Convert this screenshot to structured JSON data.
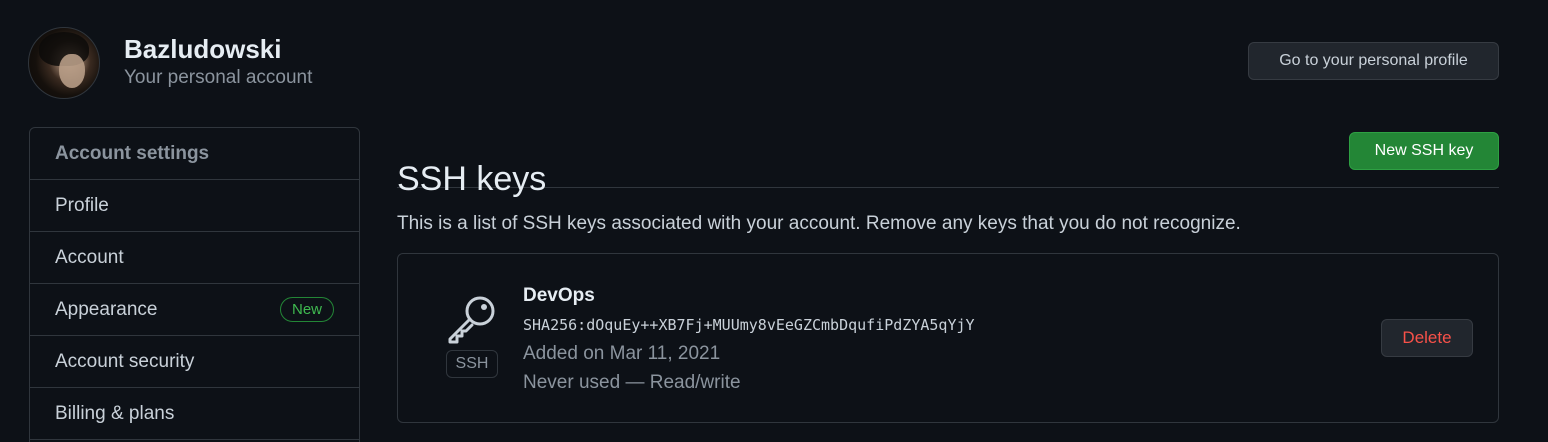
{
  "account": {
    "name": "Bazludowski",
    "subtitle": "Your personal account",
    "profile_button": "Go to your personal profile"
  },
  "sidebar": {
    "heading": "Account settings",
    "items": [
      {
        "label": "Profile"
      },
      {
        "label": "Account"
      },
      {
        "label": "Appearance",
        "badge": "New"
      },
      {
        "label": "Account security"
      },
      {
        "label": "Billing & plans"
      }
    ]
  },
  "main": {
    "title": "SSH keys",
    "new_key_button": "New SSH key",
    "description": "This is a list of SSH keys associated with your account. Remove any keys that you do not recognize.",
    "keys": [
      {
        "icon": "key-icon",
        "type_label": "SSH",
        "title": "DevOps",
        "fingerprint": "SHA256:dOquEy++XB7Fj+MUUmy8vEeGZCmbDqufiPdZYA5qYjY",
        "added": "Added on Mar 11, 2021",
        "usage": "Never used — Read/write",
        "delete_label": "Delete"
      }
    ]
  },
  "colors": {
    "background": "#0d1117",
    "border": "#30363d",
    "primary_button": "#238636",
    "danger_text": "#f85149",
    "badge_green": "#3fb950"
  }
}
